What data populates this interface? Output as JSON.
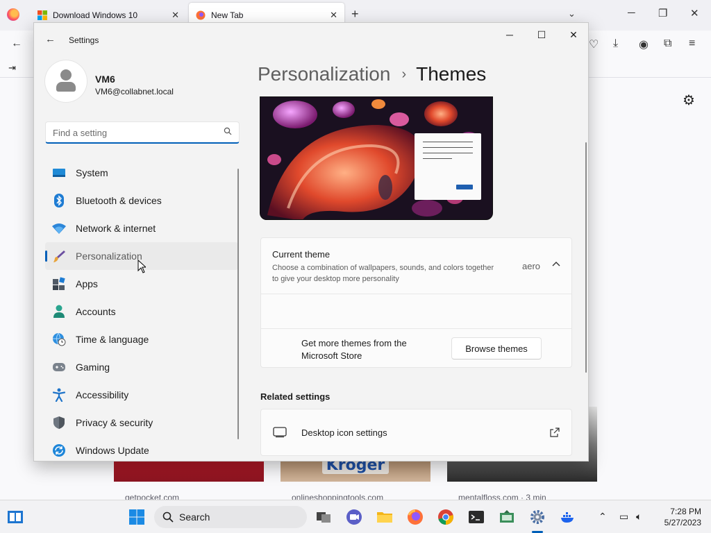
{
  "browser": {
    "tabs": [
      {
        "label": "Download Windows 10"
      },
      {
        "label": "New Tab"
      }
    ],
    "newtab_cards": [
      {
        "caption": "getpocket.com"
      },
      {
        "caption": "onlineshoppingtools.com",
        "overlay_text": "Kroger"
      },
      {
        "caption": "mentalfloss.com · 3 min"
      }
    ]
  },
  "settings": {
    "window_title": "Settings",
    "user": {
      "name": "VM6",
      "email": "VM6@collabnet.local"
    },
    "search": {
      "placeholder": "Find a setting"
    },
    "nav": [
      {
        "label": "System",
        "icon": "monitor-icon"
      },
      {
        "label": "Bluetooth & devices",
        "icon": "bluetooth-icon"
      },
      {
        "label": "Network & internet",
        "icon": "wifi-icon"
      },
      {
        "label": "Personalization",
        "icon": "brush-icon",
        "active": true
      },
      {
        "label": "Apps",
        "icon": "apps-icon"
      },
      {
        "label": "Accounts",
        "icon": "person-icon"
      },
      {
        "label": "Time & language",
        "icon": "globe-clock-icon"
      },
      {
        "label": "Gaming",
        "icon": "gamepad-icon"
      },
      {
        "label": "Accessibility",
        "icon": "accessibility-icon"
      },
      {
        "label": "Privacy & security",
        "icon": "shield-icon"
      },
      {
        "label": "Windows Update",
        "icon": "update-icon"
      }
    ],
    "breadcrumb": {
      "parent": "Personalization",
      "separator": "›",
      "current": "Themes"
    },
    "current_theme": {
      "title": "Current theme",
      "description": "Choose a combination of wallpapers, sounds, and colors together to give your desktop more personality",
      "value": "aero"
    },
    "more_themes": {
      "text": "Get more themes from the Microsoft Store",
      "button_label": "Browse themes"
    },
    "related": {
      "heading": "Related settings",
      "items": [
        {
          "label": "Desktop icon settings"
        }
      ]
    }
  },
  "taskbar": {
    "search_label": "Search",
    "time": "7:28 PM",
    "date": "5/27/2023"
  },
  "colors": {
    "accent": "#005fb8",
    "window_bg": "#f3f3f3",
    "card_bg": "#fbfbfb"
  }
}
